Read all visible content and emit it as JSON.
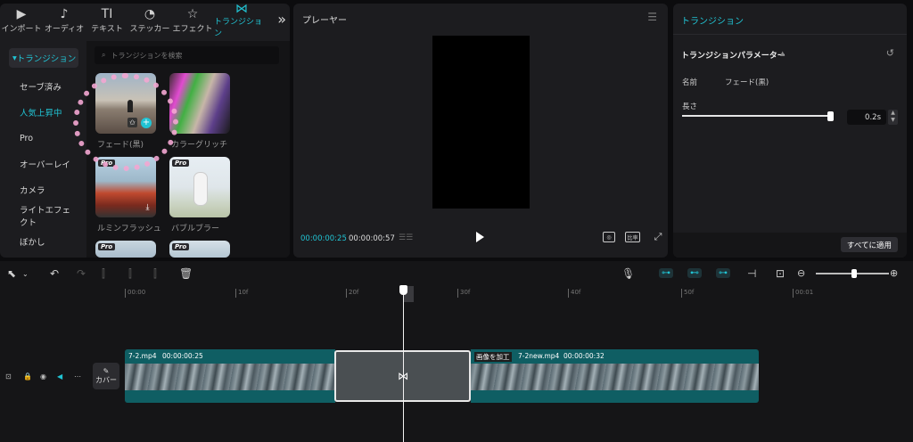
{
  "nav": {
    "tabs": [
      {
        "icon": "▶",
        "label": "インポート"
      },
      {
        "icon": "♪",
        "label": "オーディオ"
      },
      {
        "icon": "TI",
        "label": "テキスト"
      },
      {
        "icon": "◔",
        "label": "ステッカー"
      },
      {
        "icon": "☆",
        "label": "エフェクト"
      },
      {
        "icon": "⋈",
        "label": "トランジション"
      }
    ],
    "more": "»"
  },
  "sidebar": {
    "items": [
      "トランジション",
      "セーブ済み",
      "人気上昇中",
      "Pro",
      "オーバーレイ",
      "カメラ",
      "ライトエフェクト",
      "ぼかし"
    ]
  },
  "search": {
    "placeholder": "トランジションを検索"
  },
  "transitions": [
    {
      "label": "フェード(黒)"
    },
    {
      "label": "カラーグリッチ"
    },
    {
      "label": "ルミンフラッシュ",
      "badge": "Pro"
    },
    {
      "label": "バブルブラー",
      "badge": "Pro"
    },
    {
      "badge": "Pro"
    },
    {
      "badge": "Pro"
    }
  ],
  "player": {
    "title": "プレーヤー",
    "current_time": "00:00:00:25",
    "duration": "00:00:00:57",
    "ratio_label": "比率"
  },
  "panel": {
    "title": "トランジション",
    "param_title": "トランジションパラメーター",
    "name_label": "名前",
    "name_value": "フェード(黒)",
    "length_label": "長さ",
    "length_value": "0.2s",
    "length_fraction": 0.98,
    "apply_all": "すべてに適用"
  },
  "timeline": {
    "ruler": [
      "00:00",
      "10f",
      "20f",
      "30f",
      "40f",
      "50f",
      "00:01"
    ],
    "cover_label": "カバー",
    "clip1": {
      "name": "7-2.mp4",
      "time": "00:00:00:25"
    },
    "clip2": {
      "tag": "画像を加工",
      "name": "7-2new.mp4",
      "time": "00:00:00:32"
    }
  },
  "colors": {
    "accent": "#21c4d4",
    "clip": "#0f5e63",
    "annotation": "#f3a7d2"
  }
}
